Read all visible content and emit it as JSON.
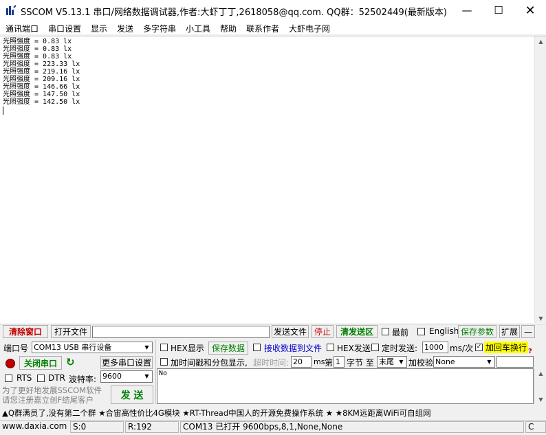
{
  "window": {
    "title": "SSCOM V5.13.1 串口/网络数据调试器,作者:大虾丁丁,2618058@qq.com. QQ群：52502449(最新版本)",
    "min_icon": "minimize-icon",
    "max_icon": "maximize-icon",
    "close_icon": "close-icon"
  },
  "menu": [
    "通讯端口",
    "串口设置",
    "显示",
    "发送",
    "多字符串",
    "小工具",
    "帮助",
    "联系作者",
    "大虾电子网"
  ],
  "receive": {
    "lines": [
      "光照强度 = 0.83 lx",
      "光照强度 = 0.83 lx",
      "光照强度 = 0.83 lx",
      "光照强度 = 223.33 lx",
      "光照强度 = 219.16 lx",
      "光照强度 = 209.16 lx",
      "光照强度 = 146.66 lx",
      "光照强度 = 147.50 lx",
      "光照强度 = 142.50 lx"
    ]
  },
  "toolbar1": {
    "clear_window": "清除窗口",
    "open_file": "打开文件",
    "send_file": "发送文件",
    "stop": "停止",
    "clear_send": "清发送区",
    "topmost": "最前",
    "english": "English",
    "save_params": "保存参数",
    "expand": "扩展",
    "collapse": "—"
  },
  "port": {
    "port_label": "端口号",
    "port_value": "COM13 USB 串行设备",
    "hex_display": "HEX显示",
    "save_data": "保存数据",
    "recv_to_file": "接收数据到文件",
    "hex_send": "HEX发送",
    "timed_send": "定时发送:",
    "interval": "1000",
    "interval_unit": "ms/次",
    "add_crlf": "加回车换行",
    "close_port": "关闭串口",
    "more_settings": "更多串口设置",
    "timestamp": "加时间戳和分包显示,",
    "timeout_label": "超时时间:",
    "timeout_value": "20",
    "ms": "ms",
    "byte_label_pre": "第",
    "byte_index": "1",
    "byte_label_post": "字节 至",
    "byte_end": "末尾",
    "checksum_label": "加校验",
    "checksum_value": "None",
    "rts": "RTS",
    "dtr": "DTR",
    "baud_label": "波特率:",
    "baud_value": "9600",
    "send_text": "No",
    "promo": "为了更好地发展SSCOM软件\n请您注册嘉立创F结尾客户",
    "send": "发 送"
  },
  "ticker": "▲Q群满员了,没有第二个群 ★合宙高性价比4G模块 ★RT-Thread中国人的开源免费操作系统 ★ ★8KM远距离WiFi可自组网",
  "status": {
    "site": "www.daxia.com",
    "sent": "S:0",
    "received": "R:192",
    "port_state": "COM13 已打开  9600bps,8,1,None,None",
    "last": "C"
  },
  "colors": {
    "accent_red": "#c00000",
    "accent_green": "#008000",
    "highlight_yellow": "#ffff00",
    "link_blue": "#0000cc"
  }
}
